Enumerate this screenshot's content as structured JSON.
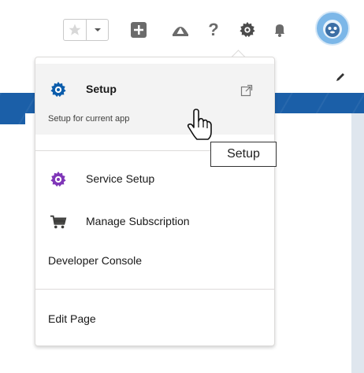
{
  "menu": {
    "setup": {
      "title": "Setup",
      "subtitle": "Setup for current app",
      "icon": "gear-icon",
      "external_icon": "external-link-icon"
    },
    "items": [
      {
        "label": "Service Setup",
        "icon": "gear-icon",
        "color": "#7f36b8"
      },
      {
        "label": "Manage Subscription",
        "icon": "cart-icon"
      },
      {
        "label": "Developer Console"
      }
    ],
    "edit_page": {
      "label": "Edit Page"
    }
  },
  "tooltip": {
    "text": "Setup"
  },
  "topbar": {
    "icons": [
      "star-icon",
      "chevron-down-icon",
      "add-icon",
      "trailhead-icon",
      "help-icon",
      "gear-icon",
      "bell-icon",
      "avatar"
    ]
  },
  "colors": {
    "accent": "#0b5cab",
    "banner": "#1b5fa8",
    "service_setup": "#7f36b8"
  }
}
